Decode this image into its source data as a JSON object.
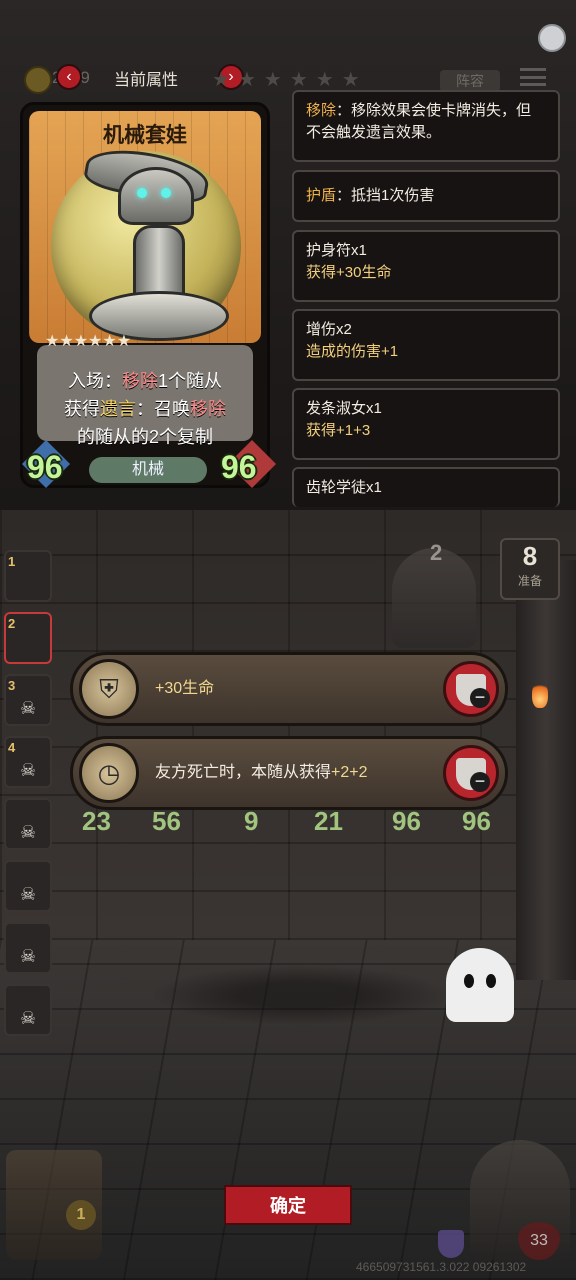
{
  "top_bar": {
    "gold_count": "2019",
    "tab_title": "当前属性",
    "roster_label": "阵容"
  },
  "card": {
    "title": "机械套娃",
    "star_count": 6,
    "stars": "★★★★★★",
    "desc_line1_prefix": "入场：",
    "desc_line1_kw": "移除",
    "desc_line1_rest": "1个随从",
    "desc_line2_prefix": "获得",
    "desc_line2_kw": "遗言",
    "desc_line2_mid": "：召唤",
    "desc_line2_kw2": "移除",
    "desc_line3": "的随从的2个复制",
    "attack": "96",
    "health": "96",
    "tribe": "机械"
  },
  "keywords": [
    {
      "name": "移除",
      "text": "：移除效果会使卡牌消失，但不会触发遗言效果。"
    },
    {
      "name": "护盾",
      "text": "：抵挡1次伤害"
    }
  ],
  "buff_list": [
    {
      "name": "护身符x1",
      "effect": "获得+30生命"
    },
    {
      "name": "增伤x2",
      "effect": "造成的伤害+1"
    },
    {
      "name": "发条淑女x1",
      "effect": "获得+1+3"
    },
    {
      "name": "齿轮学徒x1",
      "effect": ""
    }
  ],
  "roster": {
    "slots": [
      "1",
      "2",
      "3",
      "4",
      "",
      "",
      "",
      ""
    ]
  },
  "board": {
    "tier": "2",
    "gold": "8",
    "gold_label": "准备",
    "minion_stats": [
      {
        "atk": "23",
        "hp": "56"
      },
      {
        "atk": "9",
        "hp": "21"
      },
      {
        "atk": "96",
        "hp": "96"
      }
    ]
  },
  "equipment": [
    {
      "icon": "shield-crest-icon",
      "text_plain": "+30生命"
    },
    {
      "icon": "pocket-watch-icon",
      "text_plain": "友方死亡时，本随从获得",
      "text_value": "+2+2"
    }
  ],
  "bottom": {
    "confirm_label": "确定",
    "chest_count": "1",
    "health": "33",
    "version": "466509731561.3.022 09261302"
  },
  "colors": {
    "accent_red": "#b21d25",
    "keyword_orange": "#f0b24a",
    "stat_green": "#c5f59a",
    "star_gold": "#f0b73a"
  }
}
